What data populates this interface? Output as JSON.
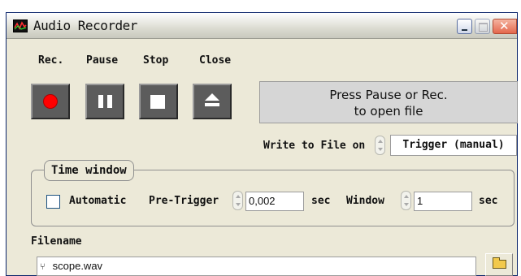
{
  "window": {
    "title": "Audio Recorder",
    "title_icon": "scope-wave-icon",
    "controls": [
      "minimize-icon",
      "maximize-icon",
      "close-icon"
    ]
  },
  "transport": {
    "rec_label": "Rec.",
    "pause_label": "Pause",
    "stop_label": "Stop",
    "close_label": "Close",
    "rec_icon": "record-icon",
    "pause_icon": "pause-icon",
    "stop_icon": "stop-icon",
    "close_icon": "eject-icon",
    "rec_color": "#ff0000"
  },
  "status": {
    "line1": "Press Pause or Rec.",
    "line2": "to open file"
  },
  "write_to_file": {
    "label": "Write to File on",
    "value": "Trigger (manual)"
  },
  "time_window": {
    "title": "Time window",
    "automatic_label": "Automatic",
    "automatic_checked": false,
    "pretrigger_label": "Pre-Trigger",
    "pretrigger_value": "0,002",
    "pretrigger_unit": "sec",
    "window_label": "Window",
    "window_value": "1",
    "window_unit": "sec"
  },
  "filename": {
    "label": "Filename",
    "value": "scope.wav",
    "path_icon": "path-icon",
    "browse_icon": "folder-icon"
  },
  "colors": {
    "panel": "#ece9d8",
    "button_face": "#5c5c5c",
    "message_bg": "#d6d6d6"
  }
}
